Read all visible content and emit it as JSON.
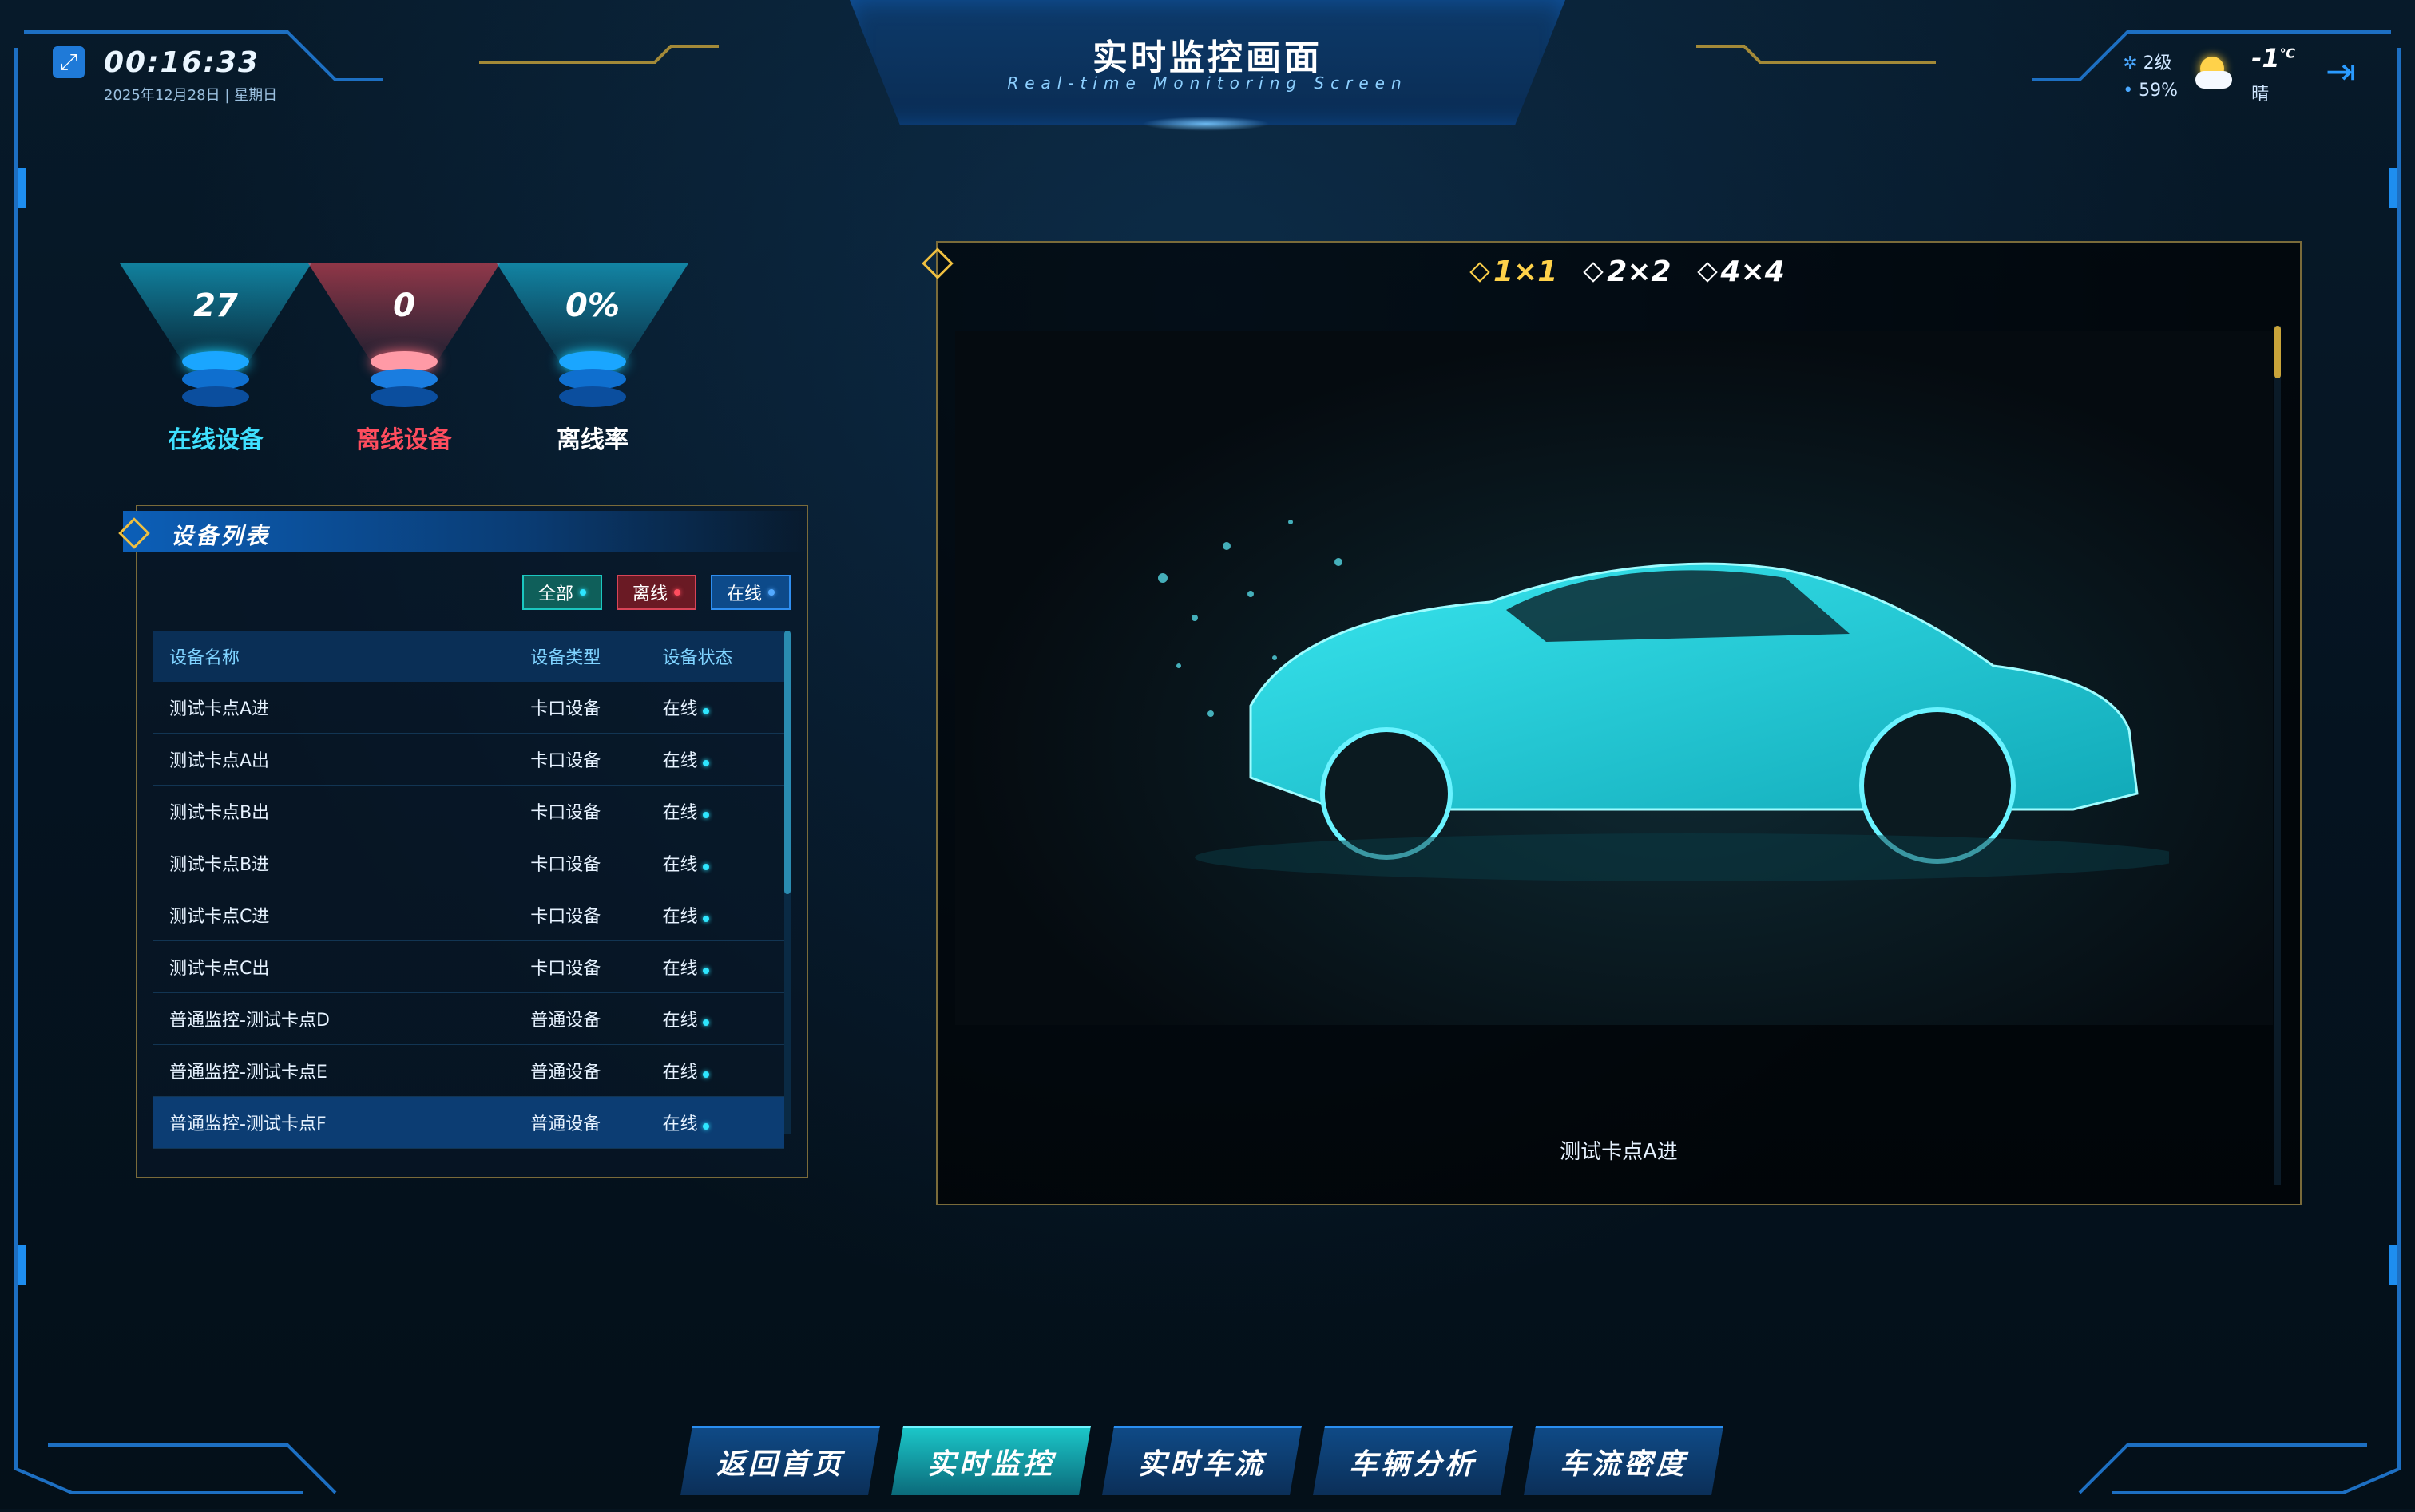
{
  "header": {
    "time": "00:16:33",
    "date": "2025年12月28日 | 星期日",
    "title": "实时监控画面",
    "subtitle": "Real-time Monitoring Screen",
    "weather": {
      "wind": "2级",
      "humidity": "59%",
      "temperature": "-1",
      "unit": "℃",
      "condition": "晴",
      "icon": "partly-sunny-icon"
    }
  },
  "stats": [
    {
      "value": "27",
      "label": "在线设备",
      "color": "#3fe0ff"
    },
    {
      "value": "0",
      "label": "离线设备",
      "color": "#ff4d5e"
    },
    {
      "value": "0%",
      "label": "离线率",
      "color": "#ffffff"
    }
  ],
  "device_list": {
    "title": "设备列表",
    "filters": [
      {
        "label": "全部",
        "type": "all"
      },
      {
        "label": "离线",
        "type": "offline"
      },
      {
        "label": "在线",
        "type": "online"
      }
    ],
    "columns": [
      "设备名称",
      "设备类型",
      "设备状态"
    ],
    "rows": [
      {
        "name": "测试卡点A进",
        "type": "卡口设备",
        "status": "在线"
      },
      {
        "name": "测试卡点A出",
        "type": "卡口设备",
        "status": "在线"
      },
      {
        "name": "测试卡点B出",
        "type": "卡口设备",
        "status": "在线"
      },
      {
        "name": "测试卡点B进",
        "type": "卡口设备",
        "status": "在线"
      },
      {
        "name": "测试卡点C进",
        "type": "卡口设备",
        "status": "在线"
      },
      {
        "name": "测试卡点C出",
        "type": "卡口设备",
        "status": "在线"
      },
      {
        "name": "普通监控-测试卡点D",
        "type": "普通设备",
        "status": "在线"
      },
      {
        "name": "普通监控-测试卡点E",
        "type": "普通设备",
        "status": "在线"
      },
      {
        "name": "普通监控-测试卡点F",
        "type": "普通设备",
        "status": "在线"
      }
    ]
  },
  "video": {
    "layouts": [
      "1×1",
      "2×2",
      "4×4"
    ],
    "active_layout": "1×1",
    "camera_label": "测试卡点A进"
  },
  "nav": {
    "tabs": [
      "返回首页",
      "实时监控",
      "实时车流",
      "车辆分析",
      "车流密度"
    ],
    "active": "实时监控"
  },
  "colors": {
    "accent": "#2a8ef0",
    "gold": "#f0c040",
    "online": "#2ee6ff",
    "offline": "#ff4d5e"
  }
}
